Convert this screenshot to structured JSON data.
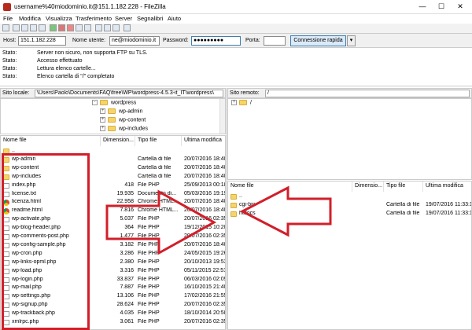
{
  "window": {
    "title": "username%40miodominio.it@151.1.182.228 - FileZilla",
    "minimize": "—",
    "maximize": "☐",
    "close": "✕"
  },
  "menu": [
    "File",
    "Modifica",
    "Visualizza",
    "Trasferimento",
    "Server",
    "Segnalibri",
    "Aiuto"
  ],
  "quickconnect": {
    "host_label": "Host:",
    "host_value": "151.1.182.228",
    "user_label": "Nome utente:",
    "user_value": "ne@miodominio.it",
    "pass_label": "Password:",
    "pass_value": "●●●●●●●●●",
    "port_label": "Porta:",
    "port_value": "",
    "connect_button": "Connessione rapida",
    "dropdown": "▾"
  },
  "log": [
    {
      "key": "Stato:",
      "text": "Server non sicuro, non supporta FTP su TLS."
    },
    {
      "key": "Stato:",
      "text": "Accesso effettuato"
    },
    {
      "key": "Stato:",
      "text": "Lettura elenco cartelle..."
    },
    {
      "key": "Stato:",
      "text": "Elenco cartella di \"/\" completato"
    }
  ],
  "local": {
    "label": "Sito locale:",
    "path": "\\Users\\Paolo\\Documents\\FAQ\\free\\WP\\wordpress-4.5.3-it_IT\\wordpress\\",
    "tree": [
      {
        "name": "wordpress",
        "expander": "-"
      },
      {
        "name": "wp-admin",
        "expander": "+"
      },
      {
        "name": "wp-content",
        "expander": "+"
      },
      {
        "name": "wp-includes",
        "expander": "+"
      }
    ],
    "columns": [
      "Nome file",
      "Dimension...",
      "Tipo file",
      "Ultima modifica"
    ],
    "files": [
      {
        "name": "..",
        "size": "",
        "type": "",
        "date": "",
        "icon": "folder"
      },
      {
        "name": "wp-admin",
        "size": "",
        "type": "Cartella di file",
        "date": "20/07/2016 18:40:...",
        "icon": "folder"
      },
      {
        "name": "wp-content",
        "size": "",
        "type": "Cartella di file",
        "date": "20/07/2016 18:40:...",
        "icon": "folder"
      },
      {
        "name": "wp-includes",
        "size": "",
        "type": "Cartella di file",
        "date": "20/07/2016 18:40:...",
        "icon": "folder"
      },
      {
        "name": "index.php",
        "size": "418",
        "type": "File PHP",
        "date": "25/09/2013 00:18:...",
        "icon": "file"
      },
      {
        "name": "license.txt",
        "size": "19.935",
        "type": "Documento di...",
        "date": "05/03/2016 19:19:...",
        "icon": "file"
      },
      {
        "name": "licenza.html",
        "size": "22.958",
        "type": "Chrome HTML...",
        "date": "20/07/2016 18:40:...",
        "icon": "chrome"
      },
      {
        "name": "readme.html",
        "size": "7.816",
        "type": "Chrome HTML...",
        "date": "20/07/2016 18:40:...",
        "icon": "chrome"
      },
      {
        "name": "wp-activate.php",
        "size": "5.037",
        "type": "File PHP",
        "date": "20/07/2016 02:35:...",
        "icon": "file"
      },
      {
        "name": "wp-blog-header.php",
        "size": "364",
        "type": "File PHP",
        "date": "19/12/2015 10:20:...",
        "icon": "file"
      },
      {
        "name": "wp-comments-post.php",
        "size": "1.477",
        "type": "File PHP",
        "date": "20/07/2016 02:35:...",
        "icon": "file"
      },
      {
        "name": "wp-config-sample.php",
        "size": "3.182",
        "type": "File PHP",
        "date": "20/07/2016 18:40:...",
        "icon": "file"
      },
      {
        "name": "wp-cron.php",
        "size": "3.286",
        "type": "File PHP",
        "date": "24/05/2015 19:26:...",
        "icon": "file"
      },
      {
        "name": "wp-links-opml.php",
        "size": "2.380",
        "type": "File PHP",
        "date": "20/10/2013 19:53:...",
        "icon": "file"
      },
      {
        "name": "wp-load.php",
        "size": "3.316",
        "type": "File PHP",
        "date": "05/11/2015 22:51:...",
        "icon": "file"
      },
      {
        "name": "wp-login.php",
        "size": "33.837",
        "type": "File PHP",
        "date": "06/03/2016 02:09:...",
        "icon": "file"
      },
      {
        "name": "wp-mail.php",
        "size": "7.887",
        "type": "File PHP",
        "date": "16/10/2015 21:40:...",
        "icon": "file"
      },
      {
        "name": "wp-settings.php",
        "size": "13.106",
        "type": "File PHP",
        "date": "17/02/2016 21:55:...",
        "icon": "file"
      },
      {
        "name": "wp-signup.php",
        "size": "28.624",
        "type": "File PHP",
        "date": "20/07/2016 02:35:...",
        "icon": "file"
      },
      {
        "name": "wp-trackback.php",
        "size": "4.035",
        "type": "File PHP",
        "date": "18/10/2014 20:58:...",
        "icon": "file"
      },
      {
        "name": "xmlrpc.php",
        "size": "3.061",
        "type": "File PHP",
        "date": "20/07/2016 02:35:...",
        "icon": "file"
      }
    ]
  },
  "remote": {
    "label": "Sito remoto:",
    "path": "/",
    "tree": [
      {
        "name": "/",
        "expander": "+"
      }
    ],
    "columns": [
      "Nome file",
      "Dimensio...",
      "Tipo file",
      "Ultima modifica"
    ],
    "files": [
      {
        "name": "..",
        "size": "",
        "type": "",
        "date": "",
        "icon": "folder"
      },
      {
        "name": "cgi-bin",
        "size": "",
        "type": "Cartella di file",
        "date": "19/07/2016 11:33:18",
        "icon": "folder"
      },
      {
        "name": "htdocs",
        "size": "",
        "type": "Cartella di file",
        "date": "19/07/2016 11:33:18",
        "icon": "folder"
      }
    ]
  },
  "colors": {
    "annotation": "#d11f2a",
    "folder": "#f6d46a",
    "connect": "#dce9f7"
  }
}
